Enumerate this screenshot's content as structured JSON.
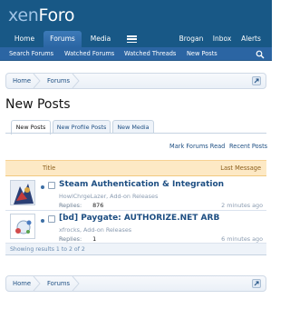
{
  "header": {
    "logo_part1": "xen",
    "logo_part2": "Foro"
  },
  "nav": {
    "tabs": [
      {
        "label": "Home"
      },
      {
        "label": "Forums"
      },
      {
        "label": "Media"
      },
      {
        "label": "Brogan"
      },
      {
        "label": "Inbox"
      },
      {
        "label": "Alerts"
      }
    ],
    "selected": "Forums"
  },
  "subnav": {
    "links": [
      {
        "label": "Search Forums"
      },
      {
        "label": "Watched Forums"
      },
      {
        "label": "Watched Threads"
      },
      {
        "label": "New Posts"
      }
    ]
  },
  "breadcrumb": {
    "items": [
      {
        "label": "Home"
      },
      {
        "label": "Forums"
      }
    ]
  },
  "page_title": "New Posts",
  "tabs": [
    {
      "label": "New Posts"
    },
    {
      "label": "New Profile Posts"
    },
    {
      "label": "New Media"
    }
  ],
  "actions": {
    "mark_read": "Mark Forums Read",
    "recent": "Recent Posts"
  },
  "table": {
    "col_title": "Title",
    "col_last": "Last Message",
    "rows": [
      {
        "title": "Steam Authentication & Integration",
        "meta": "HowlChrgeLazer, Add-on Releases",
        "replies_label": "Replies:",
        "replies": "876",
        "time": "2 minutes ago"
      },
      {
        "title": "[bd] Paygate: AUTHORIZE.NET ARB",
        "meta": "xfrocks, Add-on Releases",
        "replies_label": "Replies:",
        "replies": "1",
        "time": "6 minutes ago"
      }
    ],
    "footer": "Showing results 1 to 2 of 2"
  },
  "colors": {
    "header": "#185886",
    "subnav": "#2b65a3",
    "link": "#1d4e82",
    "thead": "#fde9c5"
  }
}
